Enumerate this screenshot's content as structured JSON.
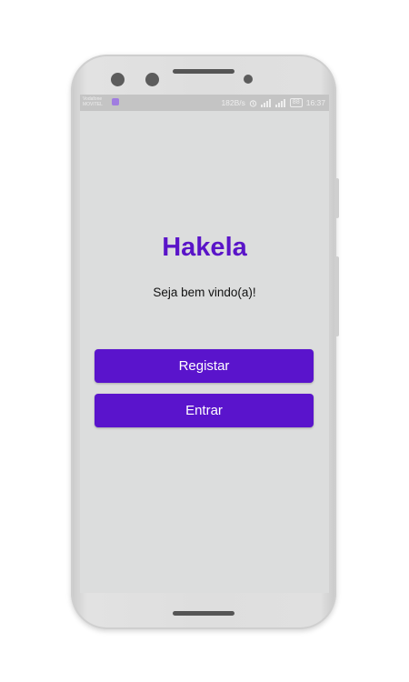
{
  "status_bar": {
    "carrier_line1": "Vodafone",
    "carrier_line2": "MOVITEL",
    "network_speed": "182B/s",
    "battery": "88",
    "time": "16:37",
    "icons": [
      "alarm-icon",
      "signal-icon",
      "signal-icon",
      "battery-icon"
    ]
  },
  "app": {
    "title": "Hakela",
    "welcome_text": "Seja bem vindo(a)!",
    "accent_color": "#5a14cc"
  },
  "actions": {
    "register_label": "Registar",
    "login_label": "Entrar"
  }
}
